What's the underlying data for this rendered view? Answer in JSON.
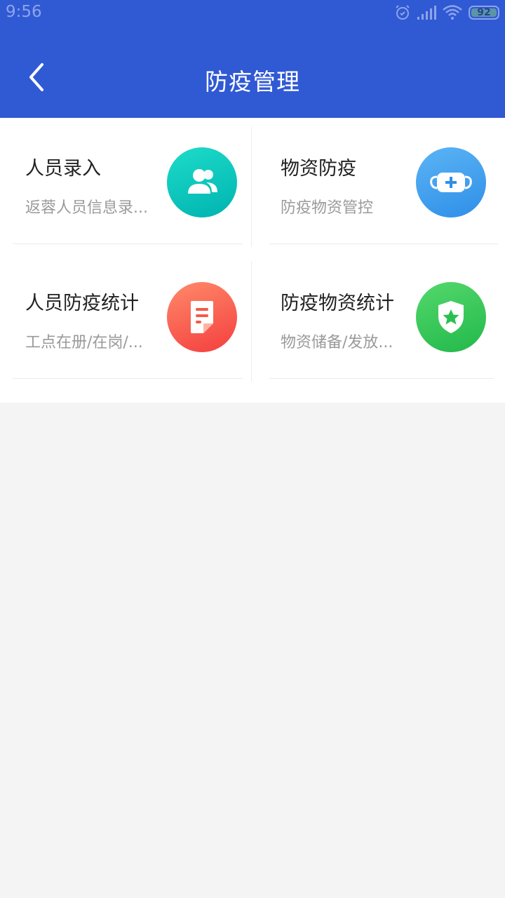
{
  "status_bar": {
    "time": "9:56",
    "battery": "92",
    "icons": [
      "alarm-icon",
      "signal-icon",
      "wifi-icon",
      "battery-icon"
    ]
  },
  "header": {
    "title": "防疫管理",
    "back_icon": "chevron-left-icon",
    "background_color": "#3059d4"
  },
  "modules": [
    {
      "title": "人员录入",
      "subtitle": "返蓉人员信息录...",
      "icon": "people-icon",
      "colors": [
        "#1ddcc9",
        "#00b3b0"
      ]
    },
    {
      "title": "物资防疫",
      "subtitle": "防疫物资管控",
      "icon": "mask-icon",
      "colors": [
        "#5bb4f5",
        "#2f8fe8"
      ]
    },
    {
      "title": "人员防疫统计",
      "subtitle": "工点在册/在岗/...",
      "icon": "document-icon",
      "colors": [
        "#ff8a6a",
        "#f43e3e"
      ]
    },
    {
      "title": "防疫物资统计",
      "subtitle": "物资储备/发放...",
      "icon": "shield-star-icon",
      "colors": [
        "#54d86c",
        "#22b84a"
      ]
    }
  ]
}
